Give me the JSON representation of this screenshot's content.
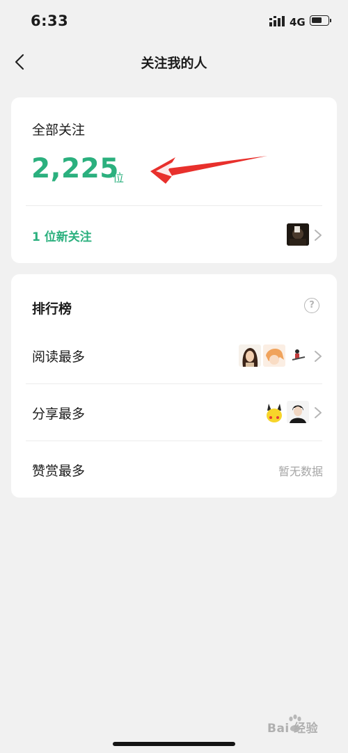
{
  "status_bar": {
    "time": "6:33",
    "network": "4G"
  },
  "navbar": {
    "title": "关注我的人"
  },
  "follow_card": {
    "label": "全部关注",
    "count": "2,225",
    "unit": "位",
    "new_follow_text": "1 位新关注"
  },
  "ranking_card": {
    "title": "排行榜",
    "help_glyph": "?",
    "rows": [
      {
        "label": "阅读最多"
      },
      {
        "label": "分享最多"
      },
      {
        "label": "赞赏最多",
        "empty_text": "暂无数据"
      }
    ]
  },
  "watermark": {
    "text": "Bai 经验"
  },
  "colors": {
    "accent": "#2bb07e",
    "annotation_arrow": "#e8302c",
    "background": "#f1f1f1"
  }
}
